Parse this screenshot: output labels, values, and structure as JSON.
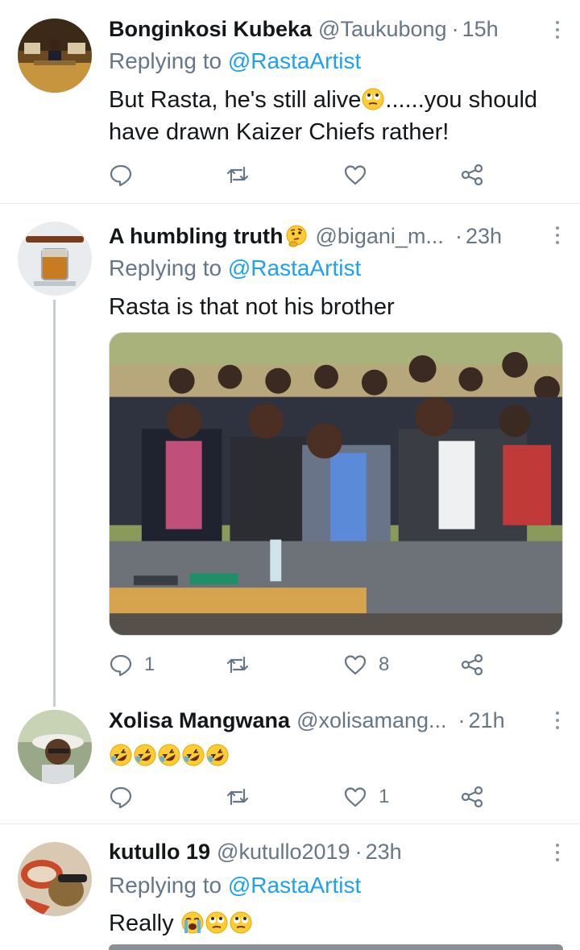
{
  "tweets": [
    {
      "name": "Bonginkosi Kubeka",
      "handle": "@Taukubong",
      "dot": "·",
      "time": "15h",
      "replying_prefix": "Replying to ",
      "replying_to": "@RastaArtist",
      "text_a": "But Rasta, he's still alive",
      "text_a_emoji": "face-with-rolling-eyes",
      "text_b": "......you should have drawn Kaizer Chiefs rather!",
      "reply_count": "",
      "retweet_count": "",
      "like_count": ""
    },
    {
      "name": "A humbling truth",
      "name_emoji": "thinking-face",
      "handle": "@bigani_m...",
      "dot": "·",
      "time": "23h",
      "replying_prefix": "Replying to ",
      "replying_to": "@RastaArtist",
      "text": "Rasta is that not his brother",
      "image_alt": "men in suits laughing at an outdoor event",
      "reply_count": "1",
      "retweet_count": "",
      "like_count": "8"
    },
    {
      "name": "Xolisa Mangwana",
      "handle": "@xolisamang...",
      "dot": "·",
      "time": "21h",
      "text_emojis": [
        "rolling-on-floor-laughing",
        "rolling-on-floor-laughing",
        "rolling-on-floor-laughing",
        "rolling-on-floor-laughing",
        "rolling-on-floor-laughing"
      ],
      "reply_count": "",
      "retweet_count": "",
      "like_count": "1"
    },
    {
      "name": "kutullo 19",
      "handle": "@kutullo2019",
      "dot": "·",
      "time": "23h",
      "replying_prefix": "Replying to ",
      "replying_to": "@RastaArtist",
      "text": "Really",
      "text_emojis": [
        "loudly-crying-face",
        "face-with-rolling-eyes",
        "face-with-rolling-eyes"
      ]
    }
  ],
  "colors": {
    "text": "#14171a",
    "secondary": "#657786",
    "link": "#1da1f2",
    "divider": "#e1e8ed",
    "thread_line": "#c4cfd6"
  },
  "icons": [
    "reply-icon",
    "retweet-icon",
    "like-icon",
    "share-icon",
    "more-options-icon"
  ]
}
